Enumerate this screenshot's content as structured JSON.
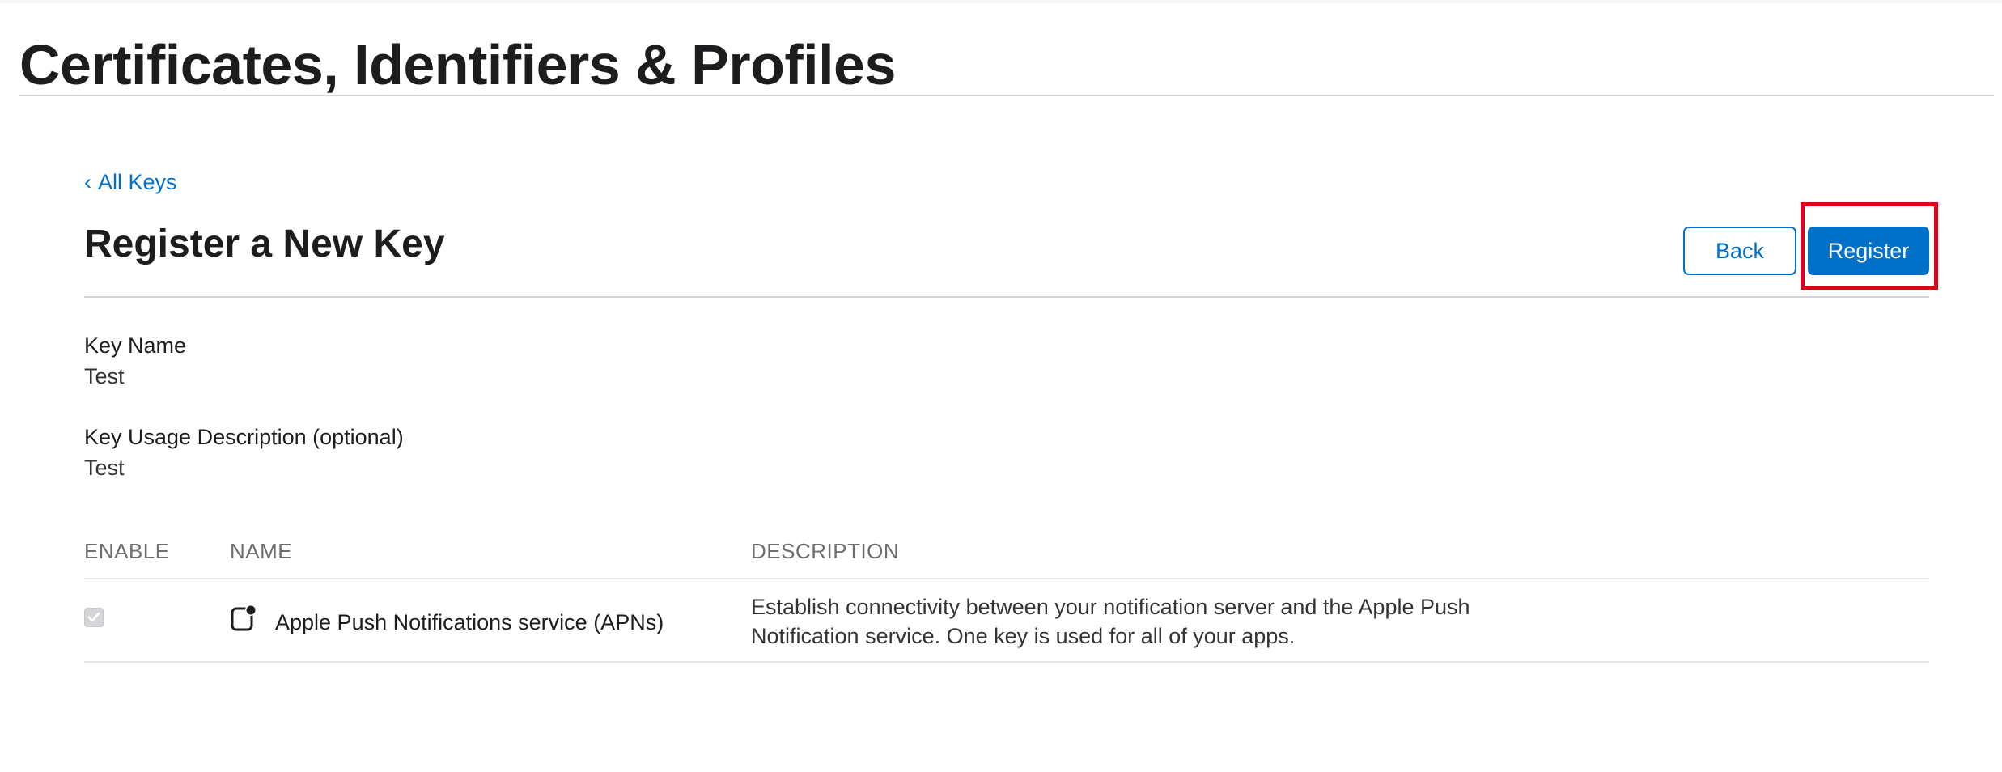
{
  "header": {
    "title": "Certificates, Identifiers & Profiles"
  },
  "nav": {
    "back_link_chevron": "‹",
    "back_link_label": "All Keys"
  },
  "page": {
    "section_title": "Register a New Key",
    "back_button_label": "Back",
    "register_button_label": "Register"
  },
  "fields": [
    {
      "label": "Key Name",
      "value": "Test"
    },
    {
      "label": "Key Usage Description (optional)",
      "value": "Test"
    }
  ],
  "table": {
    "columns": [
      "ENABLE",
      "NAME",
      "DESCRIPTION"
    ],
    "rows": [
      {
        "enabled": true,
        "icon": "push-notification-icon",
        "name": "Apple Push Notifications service (APNs)",
        "description_lines": [
          "Establish connectivity between your notification server and the Apple Push",
          "Notification service. One key is used for all of your apps."
        ]
      }
    ]
  },
  "colors": {
    "accent": "#0070c9",
    "highlight": "#e0001b",
    "text": "#1d1d1f",
    "muted": "#6e6e73"
  }
}
